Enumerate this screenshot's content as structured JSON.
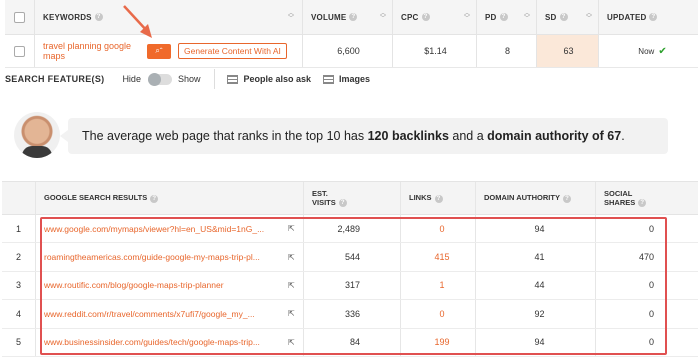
{
  "keyword_table": {
    "headers": {
      "keywords": "KEYWORDS",
      "volume": "VOLUME",
      "cpc": "CPC",
      "pd": "PD",
      "sd": "SD",
      "updated": "UPDATED"
    },
    "row": {
      "keyword": "travel planning google maps",
      "generate_button": "Generate Content With AI",
      "volume": "6,600",
      "cpc": "$1.14",
      "pd": "8",
      "sd": "63",
      "updated": "Now"
    }
  },
  "search_features": {
    "title": "SEARCH FEATURE(S)",
    "hide_label": "Hide",
    "show_label": "Show",
    "toggle_on": false,
    "features": [
      "People also ask",
      "Images"
    ]
  },
  "message": {
    "prefix": "The average web page that ranks in the top 10 has ",
    "backlinks": "120 backlinks",
    "middle": " and a ",
    "authority": "domain authority of 67",
    "suffix": "."
  },
  "results": {
    "headers": {
      "results": "GOOGLE SEARCH RESULTS",
      "visits_1": "EST.",
      "visits_2": "VISITS",
      "links": "LINKS",
      "authority": "DOMAIN AUTHORITY",
      "social_1": "SOCIAL",
      "social_2": "SHARES"
    },
    "rows": [
      {
        "idx": "1",
        "url": "www.google.com/mymaps/viewer?hl=en_US&mid=1nG_...",
        "visits": "2,489",
        "links": "0",
        "authority": "94",
        "social": "0"
      },
      {
        "idx": "2",
        "url": "roamingtheamericas.com/guide-google-my-maps-trip-pl...",
        "visits": "544",
        "links": "415",
        "authority": "41",
        "social": "470"
      },
      {
        "idx": "3",
        "url": "www.routific.com/blog/google-maps-trip-planner",
        "visits": "317",
        "links": "1",
        "authority": "44",
        "social": "0"
      },
      {
        "idx": "4",
        "url": "www.reddit.com/r/travel/comments/x7ufi7/google_my_...",
        "visits": "336",
        "links": "0",
        "authority": "92",
        "social": "0"
      },
      {
        "idx": "5",
        "url": "www.businessinsider.com/guides/tech/google-maps-trip...",
        "visits": "84",
        "links": "199",
        "authority": "94",
        "social": "0"
      }
    ]
  },
  "colors": {
    "accent": "#e8662c",
    "highlight_box": "#e05050",
    "sd_cell": "#fbe8d9"
  }
}
